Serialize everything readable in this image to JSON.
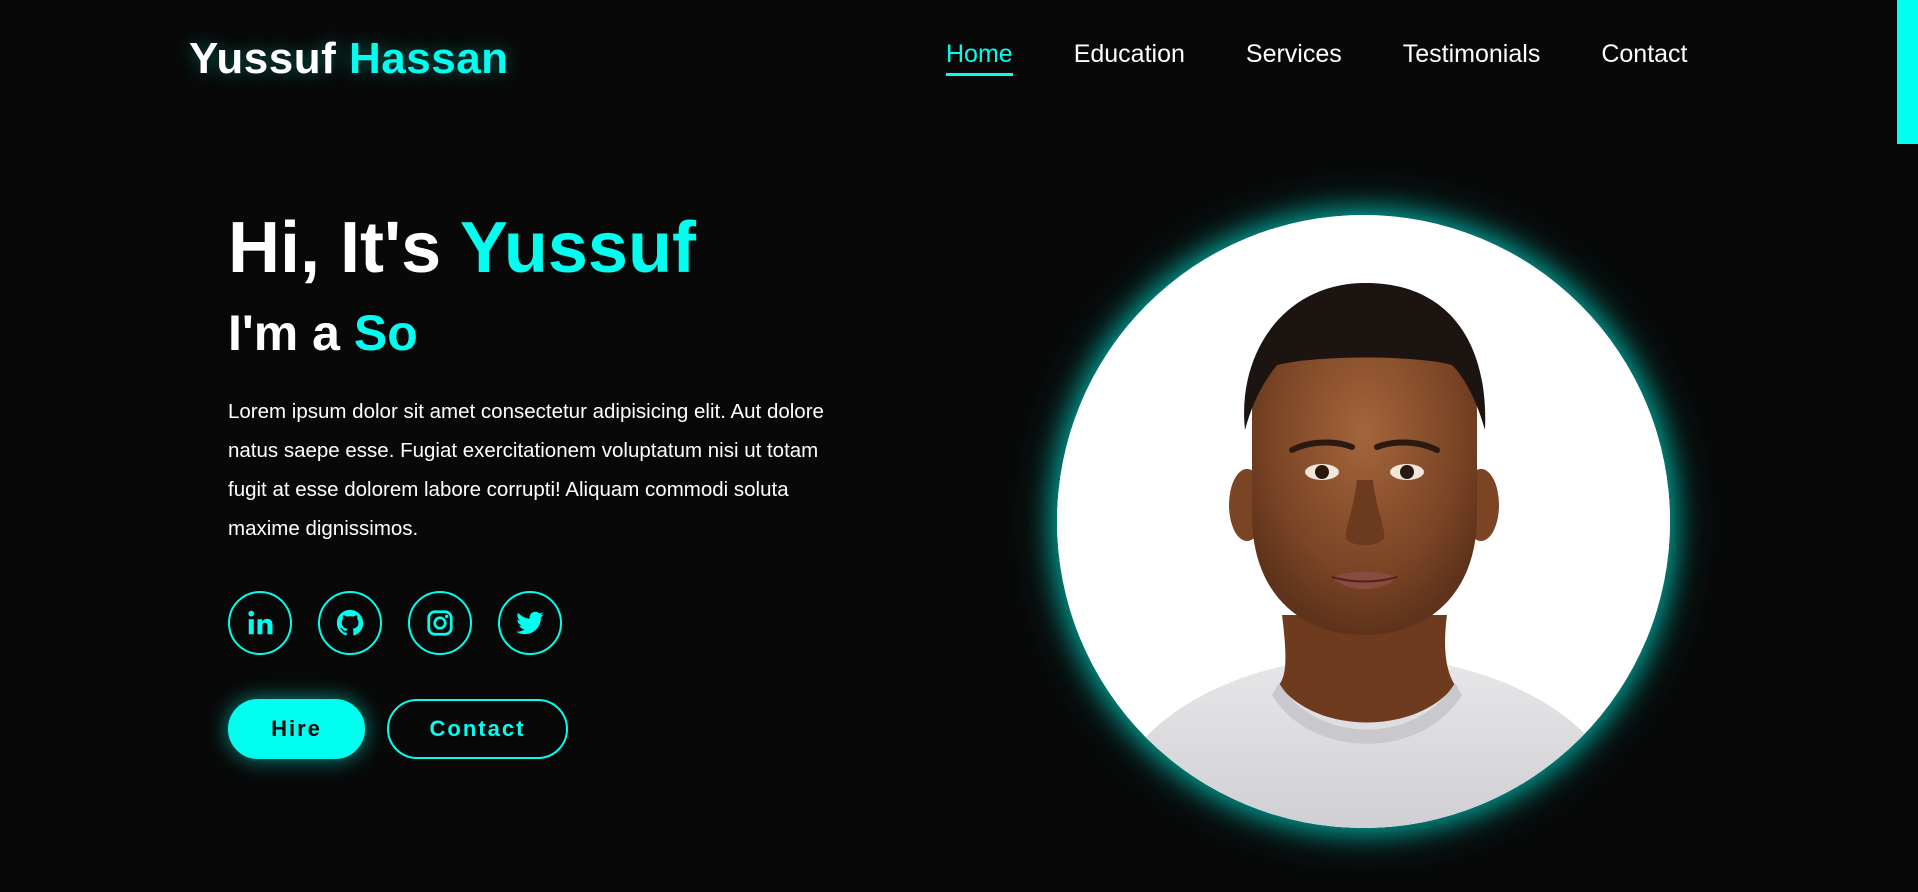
{
  "header": {
    "logo_first": "Yussuf",
    "logo_accent": "Hassan",
    "nav": [
      {
        "label": "Home",
        "active": true
      },
      {
        "label": "Education",
        "active": false
      },
      {
        "label": "Services",
        "active": false
      },
      {
        "label": "Testimonials",
        "active": false
      },
      {
        "label": "Contact",
        "active": false
      }
    ]
  },
  "hero": {
    "greeting": "Hi, It's",
    "name": "Yussuf",
    "role_prefix": "I'm a",
    "role_typed": "So",
    "description": "Lorem ipsum dolor sit amet consectetur adipisicing elit. Aut dolore natus saepe esse. Fugiat exercitationem voluptatum nisi ut totam fugit at esse dolorem labore corrupti! Aliquam commodi soluta maxime dignissimos.",
    "socials": [
      {
        "icon": "linkedin-icon"
      },
      {
        "icon": "github-icon"
      },
      {
        "icon": "instagram-icon"
      },
      {
        "icon": "twitter-icon"
      }
    ],
    "buttons": {
      "hire_label": "Hire",
      "contact_label": "Contact"
    }
  },
  "colors": {
    "accent": "#00ffee",
    "background": "#080808",
    "text": "#ffffff"
  }
}
